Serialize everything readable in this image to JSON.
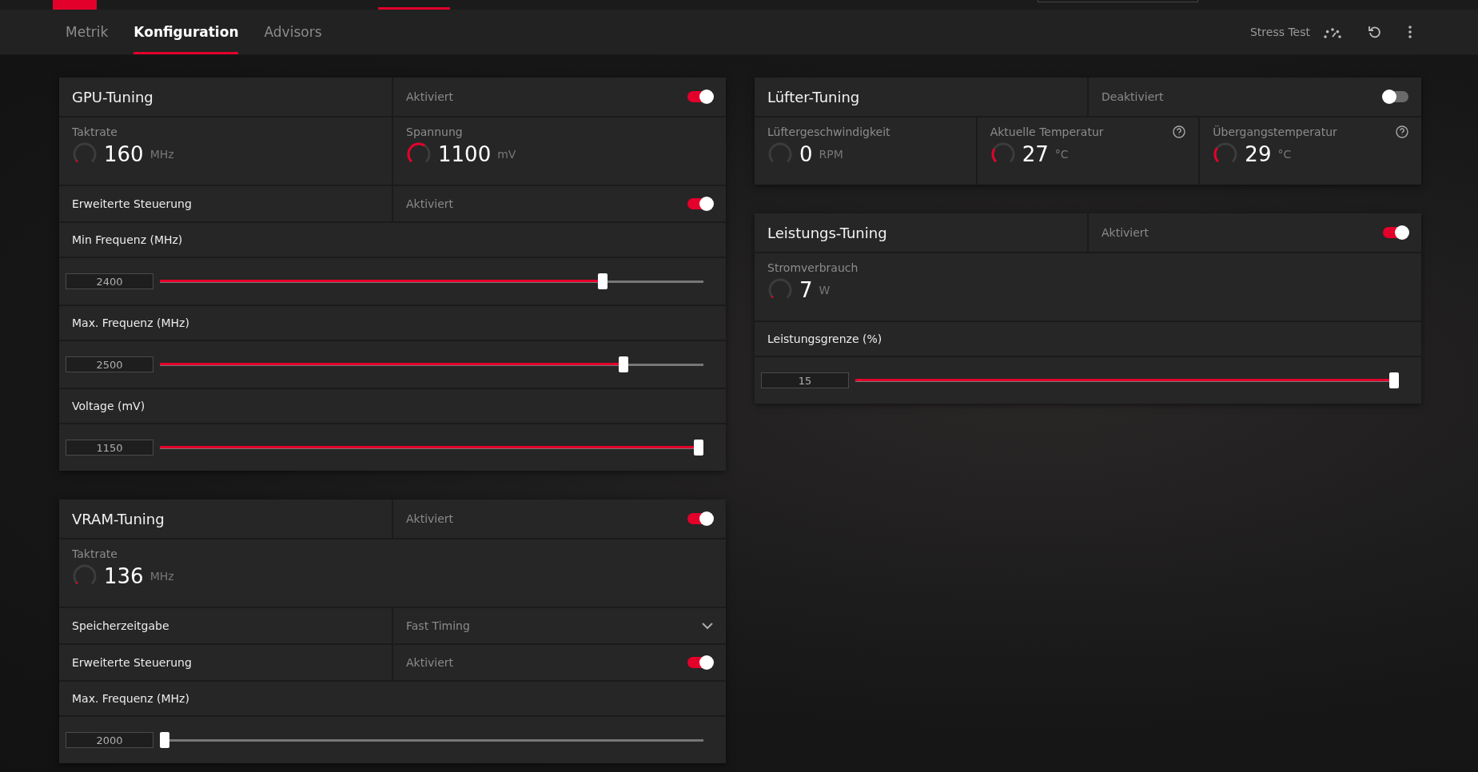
{
  "tabs": [
    {
      "label": "Metrik",
      "selected": false
    },
    {
      "label": "Konfiguration",
      "selected": true
    },
    {
      "label": "Advisors",
      "selected": false
    }
  ],
  "toolbar": {
    "stress_test": "Stress Test"
  },
  "columns": [
    [
      {
        "title": "GPU-Tuning",
        "status": "Aktiviert",
        "on": true,
        "rows": [
          {
            "kind": "metrics",
            "items": [
              {
                "label": "Taktrate",
                "value": "160",
                "unit": "MHz",
                "level": 0.03,
                "help": false
              },
              {
                "label": "Spannung",
                "value": "1100",
                "unit": "mV",
                "level": 0.62,
                "help": false
              }
            ]
          },
          {
            "kind": "toggle",
            "label": "Erweiterte Steuerung",
            "status": "Aktiviert",
            "on": true
          },
          {
            "kind": "heading",
            "label": "Min Frequenz (MHz)"
          },
          {
            "kind": "slider",
            "value": "2400",
            "level": 0.82
          },
          {
            "kind": "heading",
            "label": "Max. Frequenz (MHz)"
          },
          {
            "kind": "slider",
            "value": "2500",
            "level": 0.86
          },
          {
            "kind": "heading",
            "label": "Voltage (mV)"
          },
          {
            "kind": "slider",
            "value": "1150",
            "level": 1.0
          }
        ]
      },
      {
        "title": "VRAM-Tuning",
        "status": "Aktiviert",
        "on": true,
        "rows": [
          {
            "kind": "metrics",
            "items": [
              {
                "label": "Taktrate",
                "value": "136",
                "unit": "MHz",
                "level": 0.03,
                "help": false
              }
            ]
          },
          {
            "kind": "dropdown",
            "label": "Speicherzeitgabe",
            "value": "Fast Timing"
          },
          {
            "kind": "toggle",
            "label": "Erweiterte Steuerung",
            "status": "Aktiviert",
            "on": true
          },
          {
            "kind": "heading",
            "label": "Max. Frequenz (MHz)"
          },
          {
            "kind": "slider",
            "value": "2000",
            "level": 0.0
          }
        ]
      }
    ],
    [
      {
        "title": "Lüfter-Tuning",
        "status": "Deaktiviert",
        "on": false,
        "rows": [
          {
            "kind": "metrics",
            "items": [
              {
                "label": "Lüftergeschwindigkeit",
                "value": "0",
                "unit": "RPM",
                "level": 0.0,
                "help": false
              },
              {
                "label": "Aktuelle Temperatur",
                "value": "27",
                "unit": "°C",
                "level": 0.28,
                "help": true
              },
              {
                "label": "Übergangstemperatur",
                "value": "29",
                "unit": "°C",
                "level": 0.3,
                "help": true
              }
            ]
          }
        ]
      },
      {
        "title": "Leistungs-Tuning",
        "status": "Aktiviert",
        "on": true,
        "rows": [
          {
            "kind": "metrics",
            "items": [
              {
                "label": "Stromverbrauch",
                "value": "7",
                "unit": "W",
                "level": 0.03,
                "help": false
              }
            ]
          },
          {
            "kind": "heading",
            "label": "Leistungsgrenze (%)"
          },
          {
            "kind": "slider",
            "value": "15",
            "level": 1.0
          }
        ]
      }
    ]
  ]
}
